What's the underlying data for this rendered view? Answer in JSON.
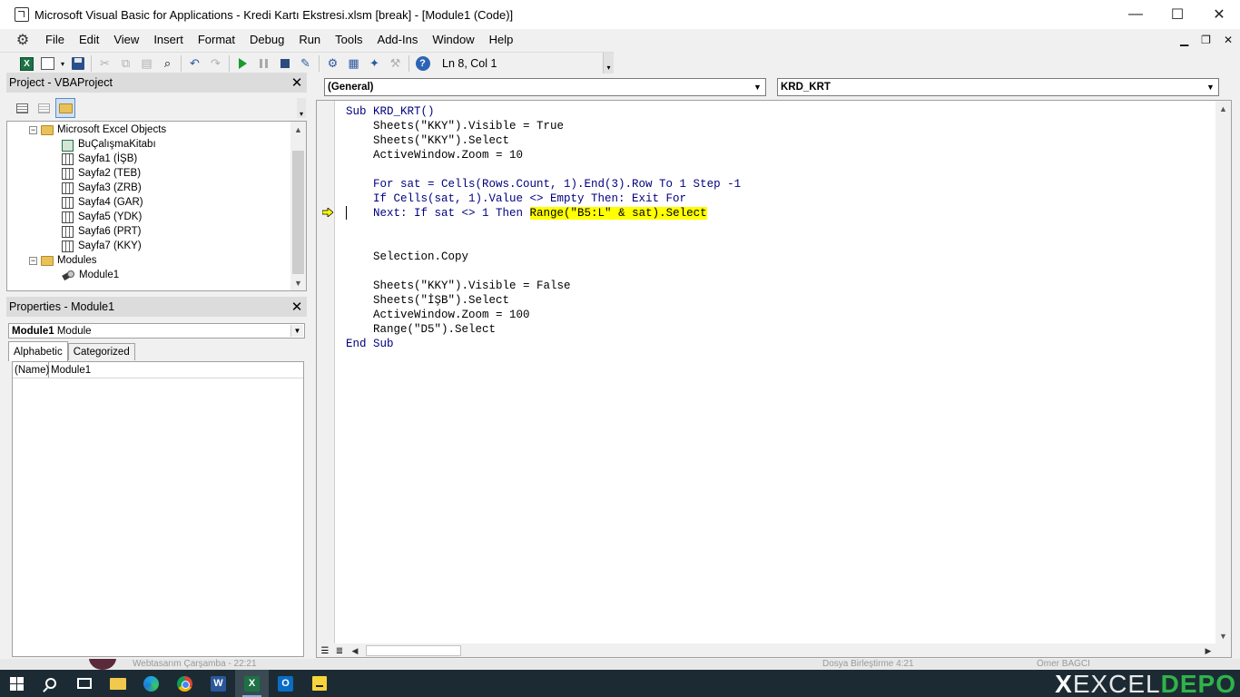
{
  "window": {
    "title": "Microsoft Visual Basic for Applications - Kredi Kartı Ekstresi.xlsm [break] - [Module1 (Code)]",
    "minimize": "—",
    "maximize": "☐",
    "close": "✕"
  },
  "menu": [
    "File",
    "Edit",
    "View",
    "Insert",
    "Format",
    "Debug",
    "Run",
    "Tools",
    "Add-Ins",
    "Window",
    "Help"
  ],
  "mdi": {
    "minimize": "▁",
    "restore": "❐",
    "close": "✕"
  },
  "toolbar": {
    "cursor_position": "Ln 8, Col 1"
  },
  "project_panel": {
    "title": "Project - VBAProject",
    "tree": [
      {
        "label": "Microsoft Excel Objects",
        "kind": "folder",
        "level": 1
      },
      {
        "label": "BuÇalışmaKitabı",
        "kind": "workbook",
        "level": 2
      },
      {
        "label": "Sayfa1 (İŞB)",
        "kind": "sheet",
        "level": 2
      },
      {
        "label": "Sayfa2 (TEB)",
        "kind": "sheet",
        "level": 2
      },
      {
        "label": "Sayfa3 (ZRB)",
        "kind": "sheet",
        "level": 2
      },
      {
        "label": "Sayfa4 (GAR)",
        "kind": "sheet",
        "level": 2
      },
      {
        "label": "Sayfa5 (YDK)",
        "kind": "sheet",
        "level": 2
      },
      {
        "label": "Sayfa6 (PRT)",
        "kind": "sheet",
        "level": 2
      },
      {
        "label": "Sayfa7 (KKY)",
        "kind": "sheet",
        "level": 2
      },
      {
        "label": "Modules",
        "kind": "folder",
        "level": 1
      },
      {
        "label": "Module1",
        "kind": "module",
        "level": 2
      }
    ]
  },
  "properties_panel": {
    "title": "Properties - Module1",
    "object_name": "Module1",
    "object_type": "Module",
    "tabs": [
      "Alphabetic",
      "Categorized"
    ],
    "rows": [
      {
        "name": "(Name)",
        "value": "Module1"
      }
    ]
  },
  "code_window": {
    "object_combo": "(General)",
    "procedure_combo": "KRD_KRT",
    "lines": [
      "Sub KRD_KRT()",
      "    Sheets(\"KKY\").Visible = True",
      "    Sheets(\"KKY\").Select",
      "    ActiveWindow.Zoom = 10",
      "",
      "    For sat = Cells(Rows.Count, 1).End(3).Row To 1 Step -1",
      "    If Cells(sat, 1).Value <> Empty Then: Exit For",
      "    Next: If sat <> 1 Then ",
      "",
      "",
      "    Selection.Copy",
      "",
      "    Sheets(\"KKY\").Visible = False",
      "    Sheets(\"İŞB\").Select",
      "    ActiveWindow.Zoom = 100",
      "    Range(\"D5\").Select",
      "End Sub"
    ],
    "highlighted_statement": "Range(\"B5:L\" & sat).Select",
    "current_line_index": 7
  },
  "background_peek": {
    "left_text": "Webtasarım   Çarşamba - 22:21",
    "mid_text": "Dosya Birleştirme   4:21",
    "right_text": "Ömer BAĞCI"
  },
  "taskbar": {
    "apps": [
      "start",
      "search",
      "task-view",
      "file-explorer",
      "edge",
      "chrome",
      "word",
      "excel",
      "outlook",
      "sticky-notes"
    ],
    "active": "excel"
  },
  "watermark": {
    "x": "X",
    "excel": "EXCEL",
    "depo": "DEPO"
  },
  "colors": {
    "highlight": "#ffff00",
    "taskbar": "#1c2b33",
    "excel_green": "#1e7145",
    "depo_green": "#2fb34a"
  }
}
